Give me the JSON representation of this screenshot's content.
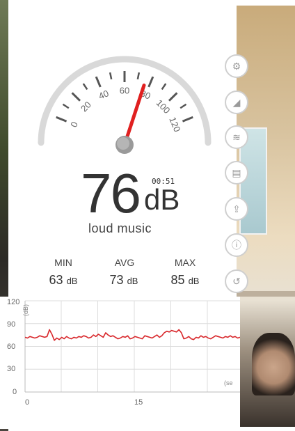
{
  "meter": {
    "gauge_ticks": [
      "0",
      "20",
      "40",
      "60",
      "80",
      "100",
      "120"
    ],
    "needle_value": 76,
    "reading": "76",
    "unit": "dB",
    "timer": "00:51",
    "description": "loud music"
  },
  "stats": {
    "min_label": "MIN",
    "min_value": "63",
    "min_unit": "dB",
    "avg_label": "AVG",
    "avg_value": "73",
    "avg_unit": "dB",
    "max_label": "MAX",
    "max_value": "85",
    "max_unit": "dB"
  },
  "graph": {
    "y_ticks": [
      "120",
      "90",
      "60",
      "30",
      "0"
    ],
    "y_unit": "(dB)",
    "x_ticks": [
      "0",
      "15"
    ],
    "x_unit": "(se",
    "line_color": "#d8262a"
  },
  "side_buttons": [
    {
      "icon": "settings-icon"
    },
    {
      "icon": "calibrate-icon"
    },
    {
      "icon": "audio-icon"
    },
    {
      "icon": "history-icon"
    },
    {
      "icon": "share-icon"
    },
    {
      "icon": "info-icon"
    },
    {
      "icon": "reset-icon"
    }
  ],
  "colors": {
    "needle": "#e02020",
    "gauge_arc": "#d9d9d9",
    "text": "#333333"
  }
}
